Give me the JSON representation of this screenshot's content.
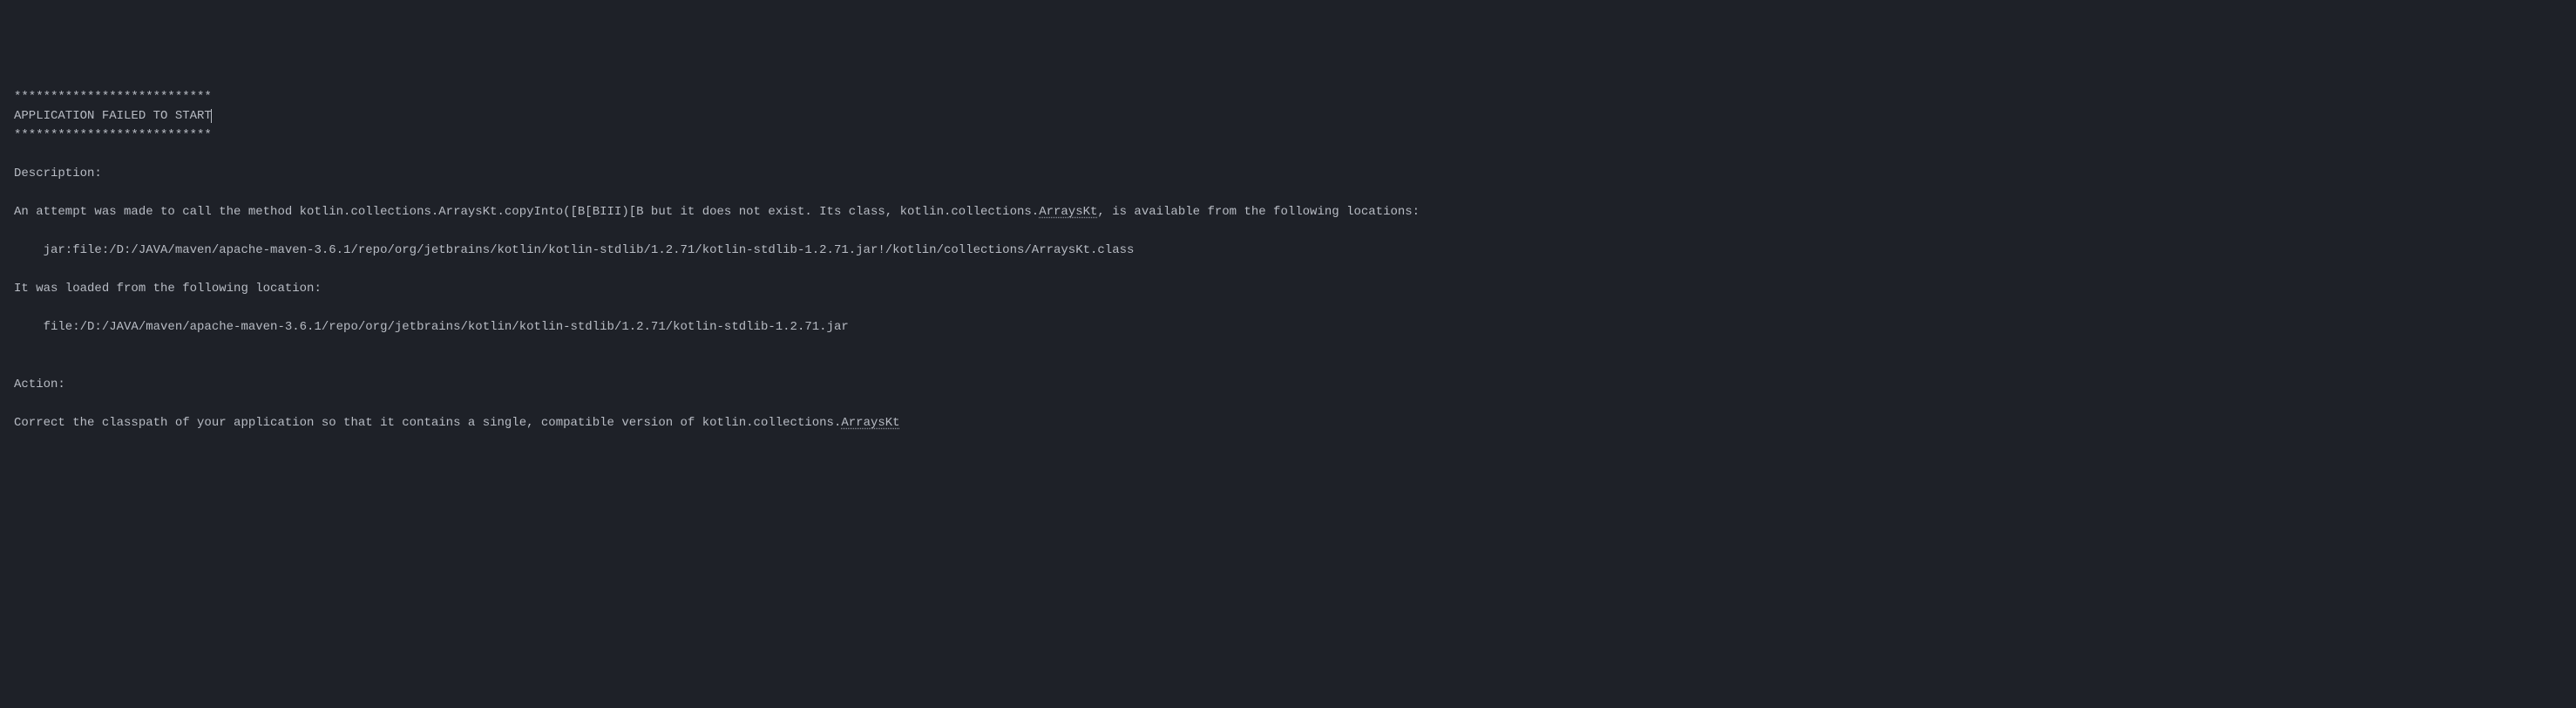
{
  "console": {
    "line1": "***************************",
    "line2": "APPLICATION FAILED TO START",
    "line3": "***************************",
    "line4": "",
    "line5": "Description:",
    "line6": "",
    "line7_prefix": "An attempt was made to call the method kotlin.collections.ArraysKt.copyInto([B[BIII)[B but it does not exist. Its class, kotlin.collections.",
    "line7_underlined": "ArraysKt",
    "line7_suffix": ", is available from the following locations:",
    "line8": "",
    "line9": "    jar:file:/D:/JAVA/maven/apache-maven-3.6.1/repo/org/jetbrains/kotlin/kotlin-stdlib/1.2.71/kotlin-stdlib-1.2.71.jar!/kotlin/collections/ArraysKt.class",
    "line10": "",
    "line11": "It was loaded from the following location:",
    "line12": "",
    "line13": "    file:/D:/JAVA/maven/apache-maven-3.6.1/repo/org/jetbrains/kotlin/kotlin-stdlib/1.2.71/kotlin-stdlib-1.2.71.jar",
    "line14": "",
    "line15": "",
    "line16": "Action:",
    "line17": "",
    "line18_prefix": "Correct the classpath of your application so that it contains a single, compatible version of kotlin.collections.",
    "line18_underlined": "ArraysKt"
  }
}
